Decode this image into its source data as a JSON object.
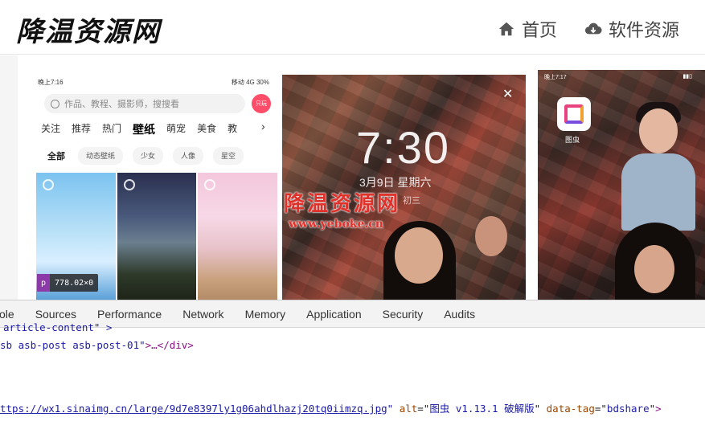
{
  "header": {
    "logo": "降温资源网",
    "nav": [
      {
        "label": "首页",
        "icon": "home-icon"
      },
      {
        "label": "软件资源",
        "icon": "cloud-download-icon"
      }
    ]
  },
  "phone1": {
    "status_time": "晚上7:16",
    "status_right": "移动 4G 30%",
    "search_placeholder": "作品、教程、摄影师，搜搜看",
    "vip_badge": "只玩",
    "categories": [
      "关注",
      "推荐",
      "热门",
      "壁纸",
      "萌宠",
      "美食",
      "教"
    ],
    "active_category": "壁纸",
    "chips": [
      "全部",
      "动态壁纸",
      "少女",
      "人像",
      "星空"
    ]
  },
  "element_tooltip": {
    "tag": "p",
    "size": "778.02×0"
  },
  "phone2": {
    "time": "7:30",
    "date": "3月9日 星期六",
    "lunar": "初三",
    "watermark": "降温资源网",
    "watermark_url": "www.yeboke.cn"
  },
  "phone3": {
    "status_time": "晚上7:17",
    "app_label": "图虫"
  },
  "devtools": {
    "tabs": [
      "sole",
      "Sources",
      "Performance",
      "Network",
      "Memory",
      "Application",
      "Security",
      "Audits"
    ],
    "line1": "article-content\" >",
    "line2_pre": "sb asb-post asb-post-01\"",
    "line2_post": ">…</div>",
    "line3_src": "ttps://wx1.sinaimg.cn/large/9d7e8397ly1g06ahdlhazj20tq0iimzq.jpg",
    "line3_alt_attr": "alt",
    "line3_alt_val": "图虫 v1.13.1 破解版",
    "line3_tag_attr": "data-tag",
    "line3_tag_val": "bdshare",
    "line3_close": ">"
  }
}
